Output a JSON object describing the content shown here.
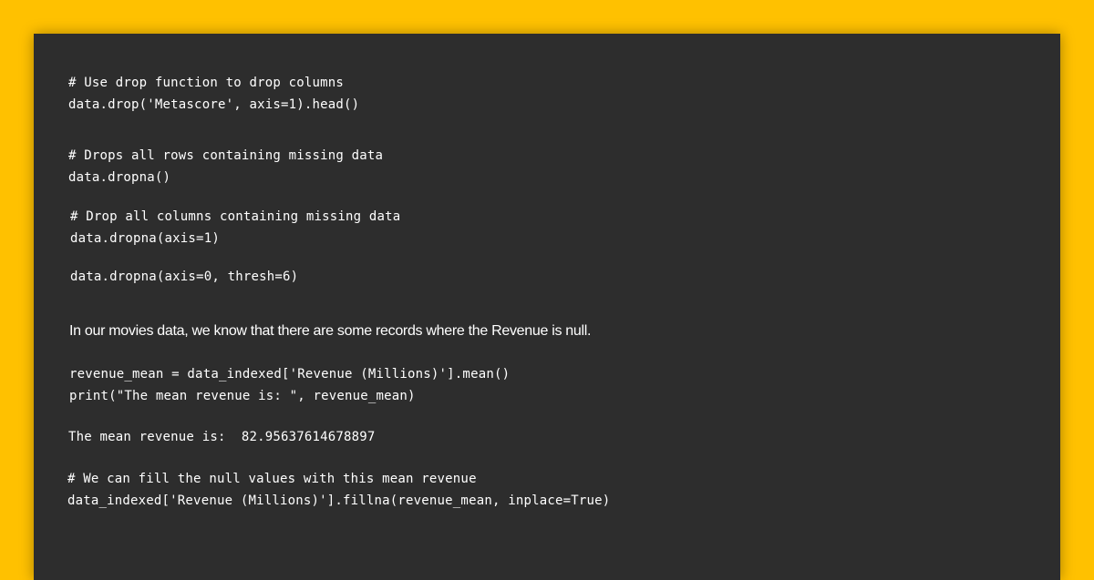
{
  "blocks": {
    "drop_column": {
      "comment": "# Use drop function to drop columns",
      "code": "data.drop('Metascore', axis=1).head()"
    },
    "drop_rows": {
      "comment": "# Drops all rows containing missing data",
      "code": "data.dropna()"
    },
    "drop_columns_missing": {
      "comment": "# Drop all columns containing missing data",
      "code": "data.dropna(axis=1)"
    },
    "drop_thresh": {
      "code": "data.dropna(axis=0, thresh=6)"
    },
    "explanation": "In our movies data, we know that there are some records where the Revenue is null.",
    "mean_calc": {
      "line1": "revenue_mean = data_indexed['Revenue (Millions)'].mean()",
      "line2": "print(\"The mean revenue is: \", revenue_mean)"
    },
    "output": "The mean revenue is:  82.95637614678897",
    "fill_null": {
      "comment": "# We can fill the null values with this mean revenue",
      "code": "data_indexed['Revenue (Millions)'].fillna(revenue_mean, inplace=True)"
    }
  },
  "colors": {
    "background": "#FFC100",
    "panel": "#2D2D2D",
    "text": "#FFFFFF"
  }
}
